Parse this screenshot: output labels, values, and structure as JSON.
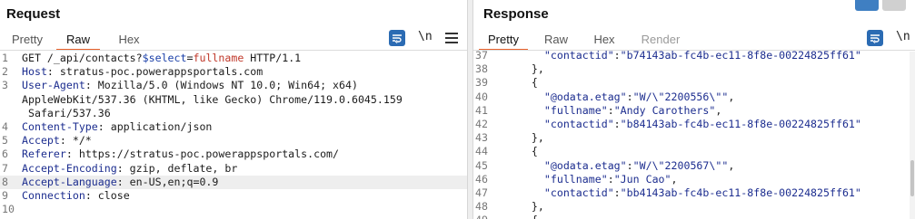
{
  "request": {
    "title": "Request",
    "tabs": [
      {
        "label": "Pretty",
        "active": false
      },
      {
        "label": "Raw",
        "active": true
      },
      {
        "label": "Hex",
        "active": false
      }
    ],
    "newline_toggle": "\\n",
    "lines": [
      {
        "n": "1",
        "parts": [
          [
            "GET /_api/contacts?",
            ""
          ],
          [
            "$select",
            "k-blue"
          ],
          [
            "=",
            ""
          ],
          [
            "fullname",
            "k-red"
          ],
          [
            " HTTP/1.1",
            ""
          ]
        ]
      },
      {
        "n": "2",
        "parts": [
          [
            "Host",
            "k-navy"
          ],
          [
            ": stratus-poc.powerappsportals.com",
            ""
          ]
        ]
      },
      {
        "n": "3",
        "parts": [
          [
            "User-Agent",
            "k-navy"
          ],
          [
            ": Mozilla/5.0 (Windows NT 10.0; Win64; x64)",
            ""
          ]
        ]
      },
      {
        "n": "",
        "parts": [
          [
            "AppleWebKit/537.36 (KHTML, like Gecko) Chrome/119.0.6045.159",
            ""
          ]
        ]
      },
      {
        "n": "",
        "parts": [
          [
            " Safari/537.36",
            ""
          ]
        ]
      },
      {
        "n": "4",
        "parts": [
          [
            "Content-Type",
            "k-navy"
          ],
          [
            ": application/json",
            ""
          ]
        ]
      },
      {
        "n": "5",
        "parts": [
          [
            "Accept",
            "k-navy"
          ],
          [
            ": */*",
            ""
          ]
        ]
      },
      {
        "n": "6",
        "parts": [
          [
            "Referer",
            "k-navy"
          ],
          [
            ": https://stratus-poc.powerappsportals.com/",
            ""
          ]
        ]
      },
      {
        "n": "7",
        "parts": [
          [
            "Accept-Encoding",
            "k-navy"
          ],
          [
            ": gzip, deflate, br",
            ""
          ]
        ]
      },
      {
        "n": "8",
        "parts": [
          [
            "Accept-Language",
            "k-navy"
          ],
          [
            ": en-US,en;q=0.9",
            ""
          ]
        ],
        "highlight": true
      },
      {
        "n": "9",
        "parts": [
          [
            "Connection",
            "k-navy"
          ],
          [
            ": close",
            ""
          ]
        ]
      },
      {
        "n": "10",
        "parts": [
          [
            "",
            ""
          ]
        ]
      }
    ]
  },
  "response": {
    "title": "Response",
    "tabs": [
      {
        "label": "Pretty",
        "active": true
      },
      {
        "label": "Raw",
        "active": false
      },
      {
        "label": "Hex",
        "active": false
      },
      {
        "label": "Render",
        "active": false,
        "disabled": true
      }
    ],
    "newline_toggle": "\\n",
    "lines": [
      {
        "n": "37",
        "parts": [
          [
            "      ",
            ""
          ],
          [
            "\"contactid\"",
            "k-navy"
          ],
          [
            ":",
            ""
          ],
          [
            "\"b74143ab-fc4b-ec11-8f8e-00224825ff61\"",
            "k-str"
          ]
        ]
      },
      {
        "n": "38",
        "parts": [
          [
            "    },",
            ""
          ]
        ]
      },
      {
        "n": "39",
        "parts": [
          [
            "    {",
            ""
          ]
        ]
      },
      {
        "n": "40",
        "parts": [
          [
            "      ",
            ""
          ],
          [
            "\"@odata.etag\"",
            "k-navy"
          ],
          [
            ":",
            ""
          ],
          [
            "\"W/\\\"2200556\\\"\"",
            "k-str"
          ],
          [
            ",",
            ""
          ]
        ]
      },
      {
        "n": "41",
        "parts": [
          [
            "      ",
            ""
          ],
          [
            "\"fullname\"",
            "k-navy"
          ],
          [
            ":",
            ""
          ],
          [
            "\"Andy Carothers\"",
            "k-str"
          ],
          [
            ",",
            ""
          ]
        ]
      },
      {
        "n": "42",
        "parts": [
          [
            "      ",
            ""
          ],
          [
            "\"contactid\"",
            "k-navy"
          ],
          [
            ":",
            ""
          ],
          [
            "\"b84143ab-fc4b-ec11-8f8e-00224825ff61\"",
            "k-str"
          ]
        ]
      },
      {
        "n": "43",
        "parts": [
          [
            "    },",
            ""
          ]
        ]
      },
      {
        "n": "44",
        "parts": [
          [
            "    {",
            ""
          ]
        ]
      },
      {
        "n": "45",
        "parts": [
          [
            "      ",
            ""
          ],
          [
            "\"@odata.etag\"",
            "k-navy"
          ],
          [
            ":",
            ""
          ],
          [
            "\"W/\\\"2200567\\\"\"",
            "k-str"
          ],
          [
            ",",
            ""
          ]
        ]
      },
      {
        "n": "46",
        "parts": [
          [
            "      ",
            ""
          ],
          [
            "\"fullname\"",
            "k-navy"
          ],
          [
            ":",
            ""
          ],
          [
            "\"Jun Cao\"",
            "k-str"
          ],
          [
            ",",
            ""
          ]
        ]
      },
      {
        "n": "47",
        "parts": [
          [
            "      ",
            ""
          ],
          [
            "\"contactid\"",
            "k-navy"
          ],
          [
            ":",
            ""
          ],
          [
            "\"bb4143ab-fc4b-ec11-8f8e-00224825ff61\"",
            "k-str"
          ]
        ]
      },
      {
        "n": "48",
        "parts": [
          [
            "    },",
            ""
          ]
        ]
      },
      {
        "n": "49",
        "parts": [
          [
            "    {",
            ""
          ]
        ]
      }
    ]
  },
  "colors": {
    "accent_underline": "#e8622c",
    "icon_blue": "#2b6bb3",
    "highlight_row": "#eeeeee"
  },
  "icons": {
    "wrap_toggle": "wrap-icon",
    "menu": "hamburger-menu-icon",
    "layout": "layout-toggle-icon"
  }
}
